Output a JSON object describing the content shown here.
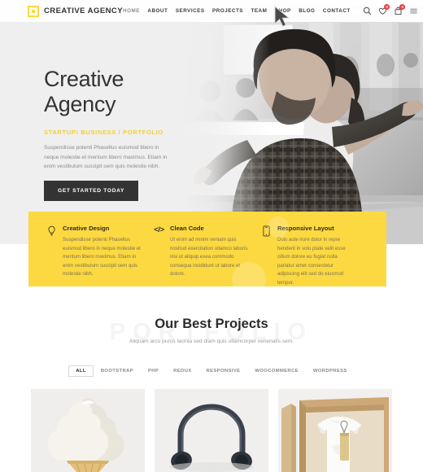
{
  "header": {
    "logo": {
      "mark": "square-logo-mark",
      "text": "CREATIVE AGENCY"
    },
    "nav_items": [
      {
        "label": "HOME",
        "active": true
      },
      {
        "label": "ABOUT",
        "active": false
      },
      {
        "label": "SERVICES",
        "active": false
      },
      {
        "label": "PROJECTS",
        "active": false
      },
      {
        "label": "TEAM",
        "active": false
      },
      {
        "label": "SHOP",
        "active": false
      },
      {
        "label": "BLOG",
        "active": false
      },
      {
        "label": "CONTACT",
        "active": false
      }
    ],
    "icons": [
      {
        "name": "search-icon",
        "badge": null
      },
      {
        "name": "wishlist-heart-icon",
        "badge": "0"
      },
      {
        "name": "cart-icon",
        "badge": "0"
      },
      {
        "name": "hamburger-menu-icon",
        "badge": null
      }
    ]
  },
  "hero": {
    "title_line1": "Creative",
    "title_line2": "Agency",
    "tagline": "STARTUP! BUSINESS / PORTFOLIO",
    "description": "Suspendisse potenti Phasellus euismod libero in neque molestie et mentum libero maximus. Etiam in enim vestibulum suscipit sem quis molestie nibh.",
    "cta_label": "GET STARTED TODAY",
    "photo_alt": "two-people-office-photo"
  },
  "features": [
    {
      "icon": "lightbulb-icon",
      "title": "Creative Design",
      "text": "Suspendisse potenti Phasellus euismod libero in neque molestie et mentum libero maximus. Etiam in enim vestibulum suscipit sem quis molestie nibh."
    },
    {
      "icon": "code-brackets-icon",
      "title": "Clean Code",
      "text": "Ut enim ad minim veniam quis nostrud exercitation ullamco laboris nisi ut aliquip exea commodo consequa incididunt ut labore et dolore."
    },
    {
      "icon": "mobile-device-icon",
      "title": "Responsive Layout",
      "text": "Duis aute irure dolor in repre henderit in volu ptate velit esse cillum dolore eu fugiat nulla pariatur amet consectetur adipiscing elit sed do eiusmod tempor."
    }
  ],
  "projects": {
    "watermark": "PORTFOLIO",
    "heading": "Our Best Projects",
    "subheading": "Aliquam arcu purus lacinia sed diam quis ullamcorper venenatis sem.",
    "filters": [
      {
        "label": "ALL",
        "active": true
      },
      {
        "label": "BOOTSTRAP",
        "active": false
      },
      {
        "label": "PHP",
        "active": false
      },
      {
        "label": "REDUX",
        "active": false
      },
      {
        "label": "RESPONSIVE",
        "active": false
      },
      {
        "label": "WOOCOMMERCE",
        "active": false
      },
      {
        "label": "WORDPRESS",
        "active": false
      }
    ],
    "cards": [
      {
        "name": "project-ice-cream"
      },
      {
        "name": "project-headphones"
      },
      {
        "name": "project-tshirt-box"
      }
    ]
  },
  "colors": {
    "accent_yellow": "#fcd941",
    "dark": "#333333",
    "badge_red": "#e8403a",
    "hero_bg": "#efefef"
  }
}
